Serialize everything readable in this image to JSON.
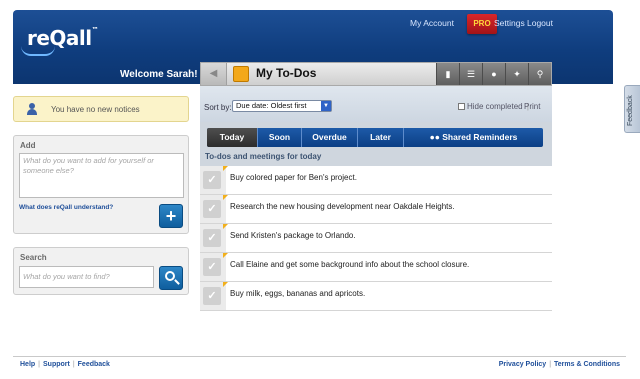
{
  "header": {
    "logo_text": "reQall",
    "logo_mark": "™",
    "welcome": "Welcome Sarah!",
    "nav": {
      "my_account": "My Account",
      "pro": "PRO",
      "settings": "Settings",
      "logout": "Logout"
    }
  },
  "todos": {
    "title": "My To-Dos",
    "toolbar_icons": [
      "note-icon",
      "list-icon",
      "people-icon",
      "pin-icon",
      "search-icon"
    ],
    "sort_label": "Sort by:",
    "sort_value": "Due date: Oldest first",
    "hide_completed": "Hide completed",
    "print": "Print",
    "tabs": [
      "Today",
      "Soon",
      "Overdue",
      "Later",
      "Shared Reminders"
    ],
    "active_tab": "Today",
    "section_label": "To-dos and meetings for today",
    "items": [
      "Buy colored paper for Ben's project.",
      "Research the new housing development near Oakdale Heights.",
      "Send Kristen's package to Orlando.",
      "Call Elaine and get some background info about the school closure.",
      "Buy milk, eggs, bananas and apricots."
    ]
  },
  "sidebar": {
    "notice": "You have no new notices",
    "add": {
      "title": "Add",
      "placeholder": "What do you want to add for yourself or someone else?",
      "link": "What does reQall understand?"
    },
    "search": {
      "title": "Search",
      "placeholder": "What do you want to find?"
    }
  },
  "footer": {
    "help": "Help",
    "support": "Support",
    "feedback": "Feedback",
    "privacy": "Privacy Policy",
    "terms": "Terms & Conditions"
  },
  "feedback_tab": "Feedback",
  "colors": {
    "header_blue": "#0f3d7e",
    "accent_blue": "#1f4f9a",
    "pro_red": "#c81d21",
    "todo_orange": "#f3a81a"
  }
}
